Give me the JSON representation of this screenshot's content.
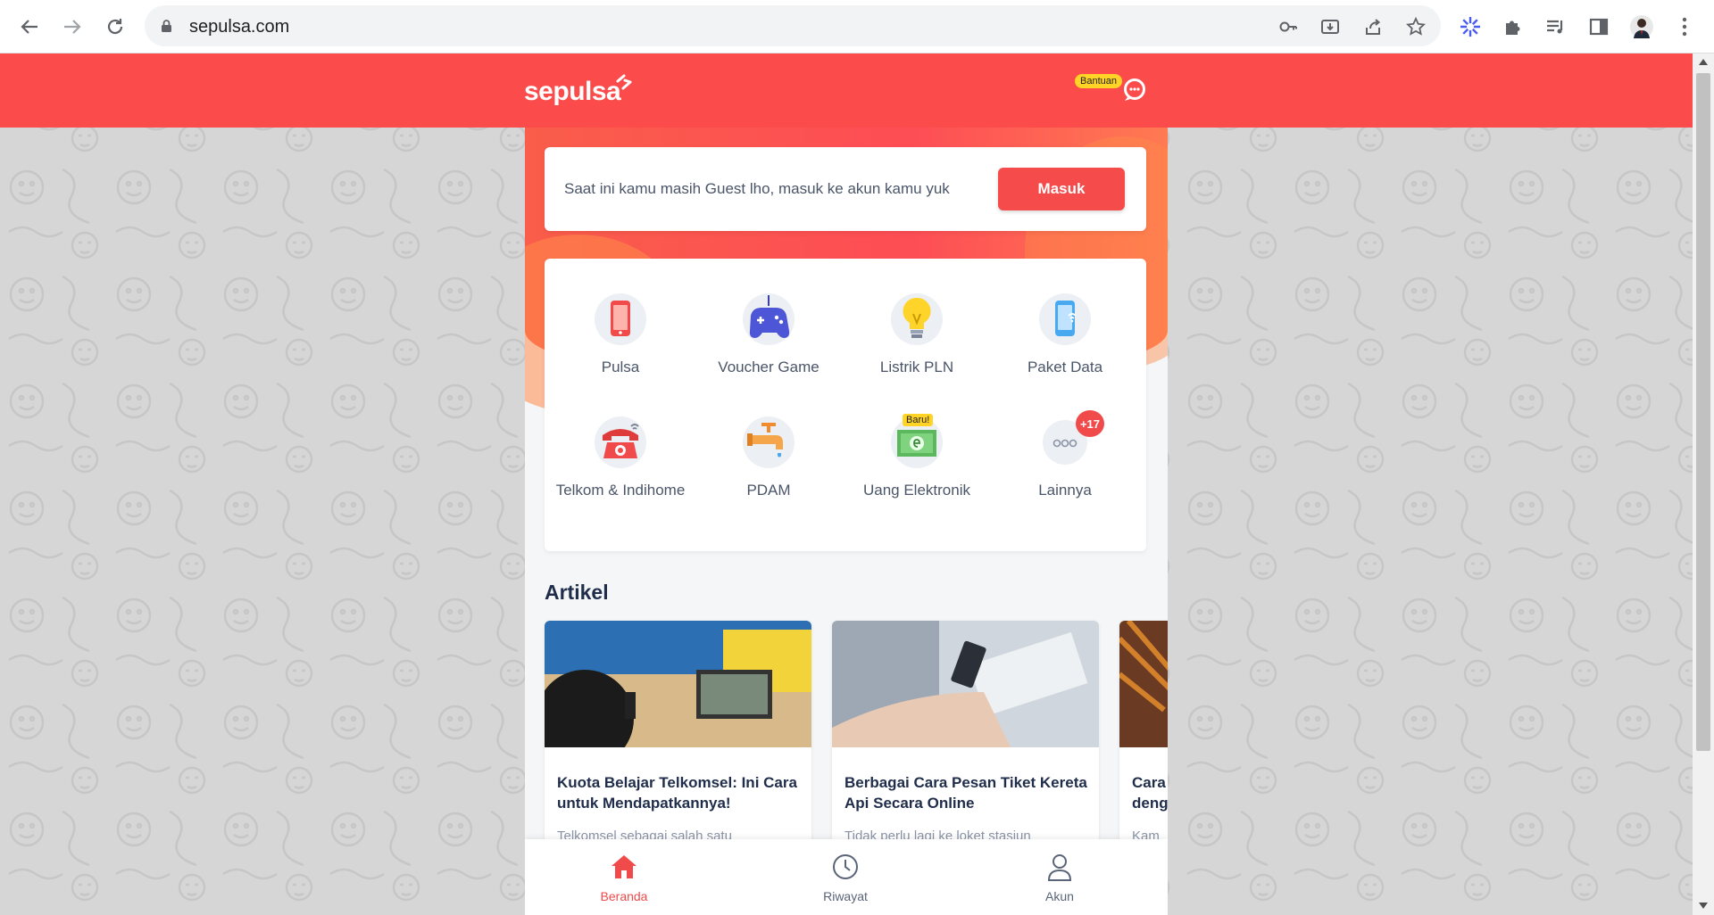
{
  "browser": {
    "url": "sepulsa.com",
    "icons": [
      "back-arrow-icon",
      "forward-arrow-icon",
      "reload-icon",
      "lock-icon",
      "key-icon",
      "install-icon",
      "share-icon",
      "bookmark-star-icon",
      "extension-sparkle-icon",
      "extensions-puzzle-icon",
      "media-playlist-icon",
      "side-panel-icon",
      "profile-avatar-icon",
      "menu-kebab-icon"
    ]
  },
  "header": {
    "logo_text": "sepulsa",
    "help_label": "Bantuan",
    "brand_color": "#fb4b4b"
  },
  "guest_banner": {
    "text": "Saat ini kamu masih Guest lho, masuk ke akun kamu yuk",
    "login_label": "Masuk"
  },
  "services": [
    {
      "label": "Pulsa",
      "icon": "phone-icon"
    },
    {
      "label": "Voucher Game",
      "icon": "gamepad-icon"
    },
    {
      "label": "Listrik PLN",
      "icon": "lightbulb-icon"
    },
    {
      "label": "Paket Data",
      "icon": "mobile-data-icon"
    },
    {
      "label": "Telkom & Indihome",
      "icon": "telephone-icon"
    },
    {
      "label": "PDAM",
      "icon": "water-faucet-icon"
    },
    {
      "label": "Uang Elektronik",
      "icon": "e-money-icon",
      "badge": "Baru!"
    },
    {
      "label": "Lainnya",
      "icon": "more-dots-icon",
      "badge": "+17"
    }
  ],
  "articles": {
    "title": "Artikel",
    "items": [
      {
        "title": "Kuota Belajar Telkomsel: Ini Cara untuk Mendapatkannya!",
        "snippet": "Telkomsel sebagai salah satu"
      },
      {
        "title": "Berbagai Cara Pesan Tiket Kereta Api Secara Online",
        "snippet": "Tidak perlu lagi ke loket stasiun"
      },
      {
        "title": "Cara deng",
        "snippet": "Kam"
      }
    ]
  },
  "bottom_nav": [
    {
      "label": "Beranda",
      "icon": "home-icon",
      "active": true
    },
    {
      "label": "Riwayat",
      "icon": "history-clock-icon",
      "active": false
    },
    {
      "label": "Akun",
      "icon": "user-account-icon",
      "active": false
    }
  ]
}
